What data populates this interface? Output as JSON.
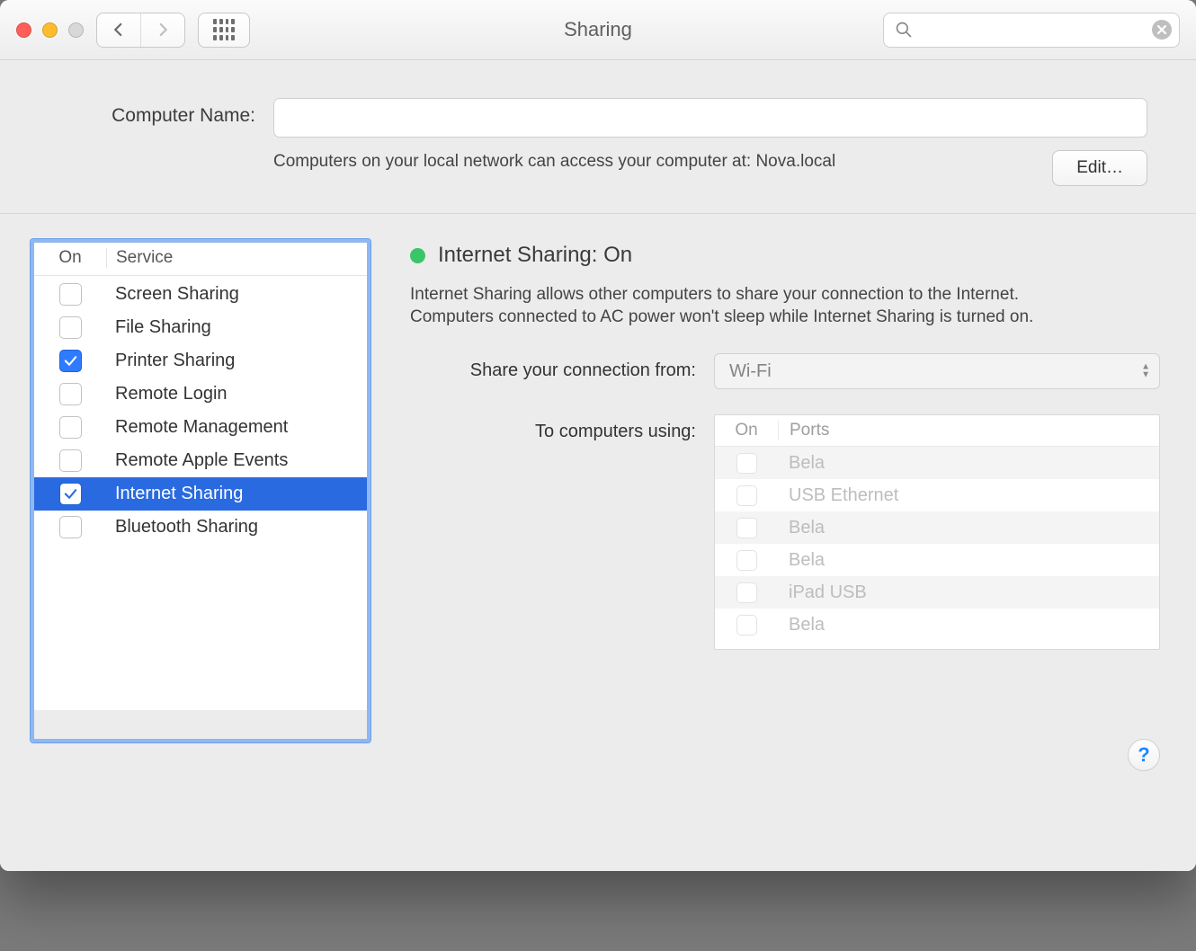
{
  "title": "Sharing",
  "search": {
    "placeholder": ""
  },
  "header": {
    "computer_name_label": "Computer Name:",
    "computer_name_value": "",
    "access_desc": "Computers on your local network can access your computer at: Nova.local",
    "edit_label": "Edit…"
  },
  "services": {
    "headers": {
      "on": "On",
      "service": "Service"
    },
    "items": [
      {
        "checked": false,
        "selected": false,
        "label": "Screen Sharing"
      },
      {
        "checked": false,
        "selected": false,
        "label": "File Sharing"
      },
      {
        "checked": true,
        "selected": false,
        "label": "Printer Sharing"
      },
      {
        "checked": false,
        "selected": false,
        "label": "Remote Login"
      },
      {
        "checked": false,
        "selected": false,
        "label": "Remote Management"
      },
      {
        "checked": false,
        "selected": false,
        "label": "Remote Apple Events"
      },
      {
        "checked": true,
        "selected": true,
        "label": "Internet Sharing"
      },
      {
        "checked": false,
        "selected": false,
        "label": "Bluetooth Sharing"
      }
    ]
  },
  "detail": {
    "status_title": "Internet Sharing: On",
    "status_color": "#3ac569",
    "description": "Internet Sharing allows other computers to share your connection to the Internet. Computers connected to AC power won't sleep while Internet Sharing is turned on.",
    "share_from_label": "Share your connection from:",
    "share_from_value": "Wi-Fi",
    "to_computers_label": "To computers using:",
    "ports": {
      "headers": {
        "on": "On",
        "ports": "Ports"
      },
      "items": [
        {
          "checked": false,
          "label": "Bela"
        },
        {
          "checked": false,
          "label": "USB Ethernet"
        },
        {
          "checked": false,
          "label": "Bela"
        },
        {
          "checked": false,
          "label": "Bela"
        },
        {
          "checked": false,
          "label": "iPad USB"
        },
        {
          "checked": false,
          "label": "Bela"
        }
      ]
    }
  },
  "help_label": "?"
}
